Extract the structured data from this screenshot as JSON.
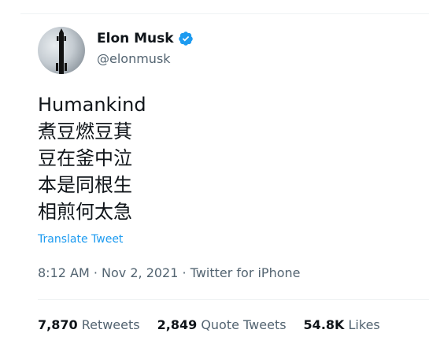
{
  "user": {
    "display_name": "Elon Musk",
    "handle": "@elonmusk",
    "verified": true
  },
  "tweet": {
    "lines": [
      "Humankind",
      "煮豆燃豆萁",
      "豆在釜中泣",
      "本是同根生",
      "相煎何太急"
    ],
    "translate_label": "Translate Tweet",
    "time": "8:12 AM",
    "date": "Nov 2, 2021",
    "source": "Twitter for iPhone",
    "separator": " · "
  },
  "stats": {
    "retweets_count": "7,870",
    "retweets_label": "Retweets",
    "quote_count": "2,849",
    "quote_label": "Quote Tweets",
    "likes_count": "54.8K",
    "likes_label": "Likes"
  },
  "colors": {
    "accent": "#1d9bf0",
    "text_primary": "#0f1419",
    "text_secondary": "#536471",
    "divider": "#eff3f4"
  },
  "icons": {
    "verified": "verified-badge-icon"
  }
}
